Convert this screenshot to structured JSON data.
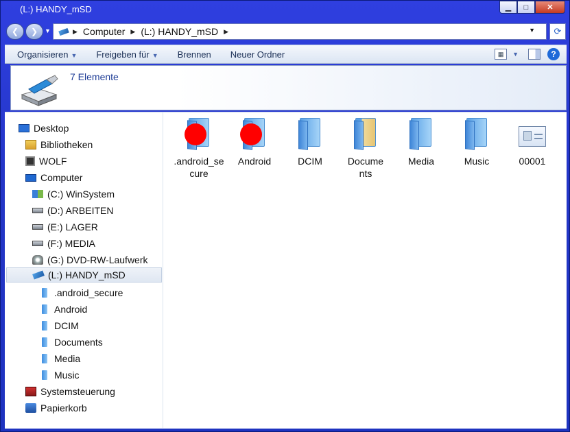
{
  "window": {
    "title": "(L:) HANDY_mSD"
  },
  "address": {
    "crumbs": [
      "Computer",
      "(L:) HANDY_mSD"
    ]
  },
  "toolbar": {
    "organize": "Organisieren",
    "share": "Freigeben für",
    "burn": "Brennen",
    "new_folder": "Neuer Ordner"
  },
  "details": {
    "count": "7 Elemente"
  },
  "nav": {
    "items": [
      {
        "label": "Desktop",
        "icon": "desktop-icon"
      },
      {
        "label": "Bibliotheken",
        "icon": "libraries-icon"
      },
      {
        "label": "WOLF",
        "icon": "user-pc-icon"
      },
      {
        "label": "Computer",
        "icon": "computer-icon"
      },
      {
        "label": "(C:) WinSystem",
        "icon": "windows-drive-icon"
      },
      {
        "label": "(D:) ARBEITEN",
        "icon": "drive-icon"
      },
      {
        "label": "(E:) LAGER",
        "icon": "drive-icon"
      },
      {
        "label": "(F:) MEDIA",
        "icon": "drive-icon"
      },
      {
        "label": "(G:) DVD-RW-Laufwerk",
        "icon": "dvd-drive-icon"
      },
      {
        "label": "(L:) HANDY_mSD",
        "icon": "usb-drive-icon"
      },
      {
        "label": ".android_secure",
        "icon": "folder-icon"
      },
      {
        "label": "Android",
        "icon": "folder-icon"
      },
      {
        "label": "DCIM",
        "icon": "folder-icon"
      },
      {
        "label": "Documents",
        "icon": "folder-icon"
      },
      {
        "label": "Media",
        "icon": "folder-icon"
      },
      {
        "label": "Music",
        "icon": "folder-icon"
      },
      {
        "label": "Systemsteuerung",
        "icon": "control-panel-icon"
      },
      {
        "label": "Papierkorb",
        "icon": "recycle-bin-icon"
      }
    ]
  },
  "files": [
    {
      "label": ".android_secure",
      "type": "folder"
    },
    {
      "label": "Android",
      "type": "folder"
    },
    {
      "label": "DCIM",
      "type": "folder"
    },
    {
      "label": "Documents",
      "type": "folder"
    },
    {
      "label": "Media",
      "type": "folder"
    },
    {
      "label": "Music",
      "type": "folder"
    },
    {
      "label": "00001",
      "type": "contact"
    }
  ],
  "colors": {
    "accent": "#1e3c96",
    "window": "#2436c8",
    "marker": "#ff0000"
  }
}
